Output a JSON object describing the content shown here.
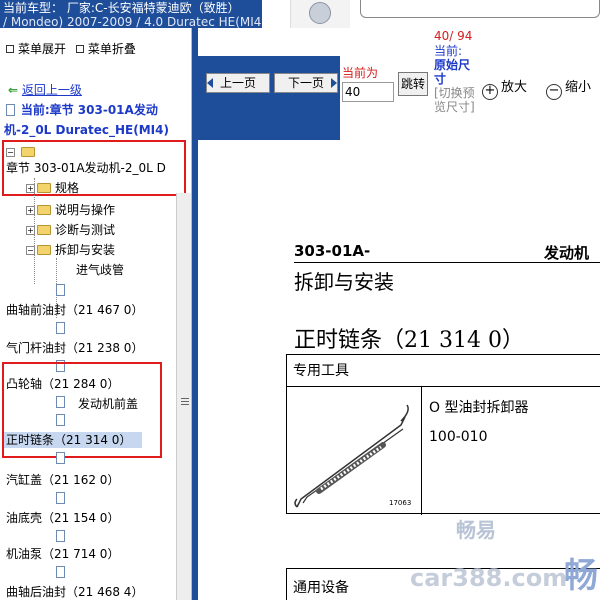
{
  "header": {
    "vehicle_title_line1": "当前车型：  厂家:C-长安福特蒙迪欧（致胜）",
    "vehicle_title_line2": "/ Mondeo) 2007-2009 / 4.0 Duratec HE(MI4)"
  },
  "sidebar": {
    "expand_label": "菜单展开",
    "collapse_label": "菜单折叠",
    "back_link": "返回上一级",
    "current_chapter_line1": "当前:章节 303-01A发动",
    "current_chapter_line2": "机-2_0L Duratec_HE(MI4)",
    "tree": {
      "root_label": "章节 303-01A发动机-2_0L D",
      "folders": [
        "规格",
        "说明与操作",
        "诊断与测试",
        "拆卸与安装"
      ],
      "doc_items": [
        {
          "label": "进气歧管"
        },
        {
          "label": "曲轴前油封（21 467 0）"
        },
        {
          "label": "气门杆油封（21 238 0）"
        },
        {
          "label": "凸轮轴（21 284 0）"
        },
        {
          "label": "发动机前盖"
        },
        {
          "label": "正时链条（21 314 0）"
        },
        {
          "label": "汽缸盖（21 162 0）"
        },
        {
          "label": "油底壳（21 154 0）"
        },
        {
          "label": "机油泵（21 714 0）"
        },
        {
          "label": "曲轴后油封（21 468 4）"
        }
      ]
    }
  },
  "toolbar": {
    "prev_label": "上一页",
    "next_label": "下一页",
    "current_label": "当前为",
    "page_value": "40",
    "jump_label": "跳转",
    "page_count": "40/ 94",
    "size_current_label": "当前:",
    "size_original_label": "原始尺寸",
    "size_toggle_label": "[切换预览尺寸]",
    "zoom_in_label": "放大",
    "zoom_out_label": "缩小"
  },
  "document": {
    "code": "303-01A-",
    "system": "发动机",
    "section": "拆卸与安装",
    "heading": "正时链条（21 314 0）",
    "tool_table_header": "专用工具",
    "tool_name": "O 型油封拆卸器",
    "tool_code": "100-010",
    "tool_image_number": "17063",
    "general_header": "通用设备",
    "watermark_1": "畅易",
    "watermark_2": "car388.com",
    "watermark_3": "畅"
  },
  "colors": {
    "accent_blue": "#1e4d9a",
    "highlight_red": "#e01b1b",
    "link_blue": "#1c39c8"
  }
}
